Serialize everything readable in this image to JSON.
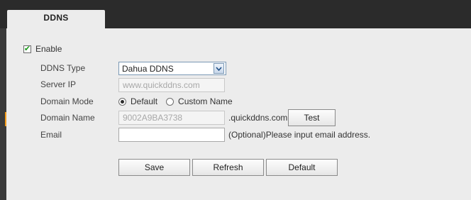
{
  "tab": {
    "title": "DDNS"
  },
  "enable": {
    "label": "Enable",
    "checked": true
  },
  "ddns_type": {
    "label": "DDNS Type",
    "value": "Dahua DDNS"
  },
  "server_ip": {
    "label": "Server IP",
    "value": "www.quickddns.com"
  },
  "domain_mode": {
    "label": "Domain Mode",
    "options": [
      {
        "label": "Default",
        "selected": true
      },
      {
        "label": "Custom Name",
        "selected": false
      }
    ]
  },
  "domain_name": {
    "label": "Domain Name",
    "value": "9002A9BA3738",
    "suffix": ".quickddns.com",
    "test_label": "Test"
  },
  "email": {
    "label": "Email",
    "value": "",
    "hint": "(Optional)Please input email address."
  },
  "buttons": {
    "save": "Save",
    "refresh": "Refresh",
    "default": "Default"
  },
  "colors": {
    "accent": "#f39b1a",
    "dark_bar": "#2b2b2b",
    "panel": "#ececec"
  }
}
